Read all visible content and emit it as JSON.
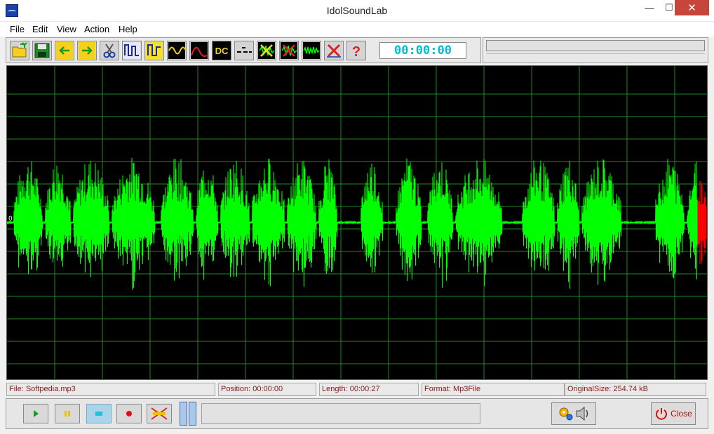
{
  "window": {
    "title": "IdolSoundLab",
    "minimize_glyph": "—",
    "maximize_glyph": "☐",
    "close_glyph": "✕"
  },
  "menu": [
    "File",
    "Edit",
    "View",
    "Action",
    "Help"
  ],
  "toolbar": {
    "buttons": [
      {
        "name": "open-icon"
      },
      {
        "name": "save-icon"
      },
      {
        "name": "back-arrow-icon"
      },
      {
        "name": "forward-arrow-icon"
      },
      {
        "name": "scissors-icon"
      },
      {
        "name": "normalize-icon"
      },
      {
        "name": "amplify-icon"
      },
      {
        "name": "sine-wave-icon"
      },
      {
        "name": "single-wave-icon"
      },
      {
        "name": "dc-icon",
        "text": "DC"
      },
      {
        "name": "silence-icon"
      },
      {
        "name": "delete-selection-icon"
      },
      {
        "name": "delete-crop-icon"
      },
      {
        "name": "noise-icon"
      },
      {
        "name": "cross-icon"
      },
      {
        "name": "help-icon"
      }
    ],
    "time": "00:00:00"
  },
  "waveform": {
    "zero_label": "0",
    "colors": {
      "background": "#000000",
      "grid": "#1f8a1f",
      "wave": "#00ff00",
      "highlight": "#ff0000"
    }
  },
  "status": {
    "file": "File: Softpedia.mp3",
    "position": "Position: 00:00:00",
    "length": "Length: 00:00:27",
    "format": "Format: Mp3File",
    "original_size": "OriginalSize: 254.74 kB"
  },
  "transport": {
    "close_label": "Close"
  }
}
